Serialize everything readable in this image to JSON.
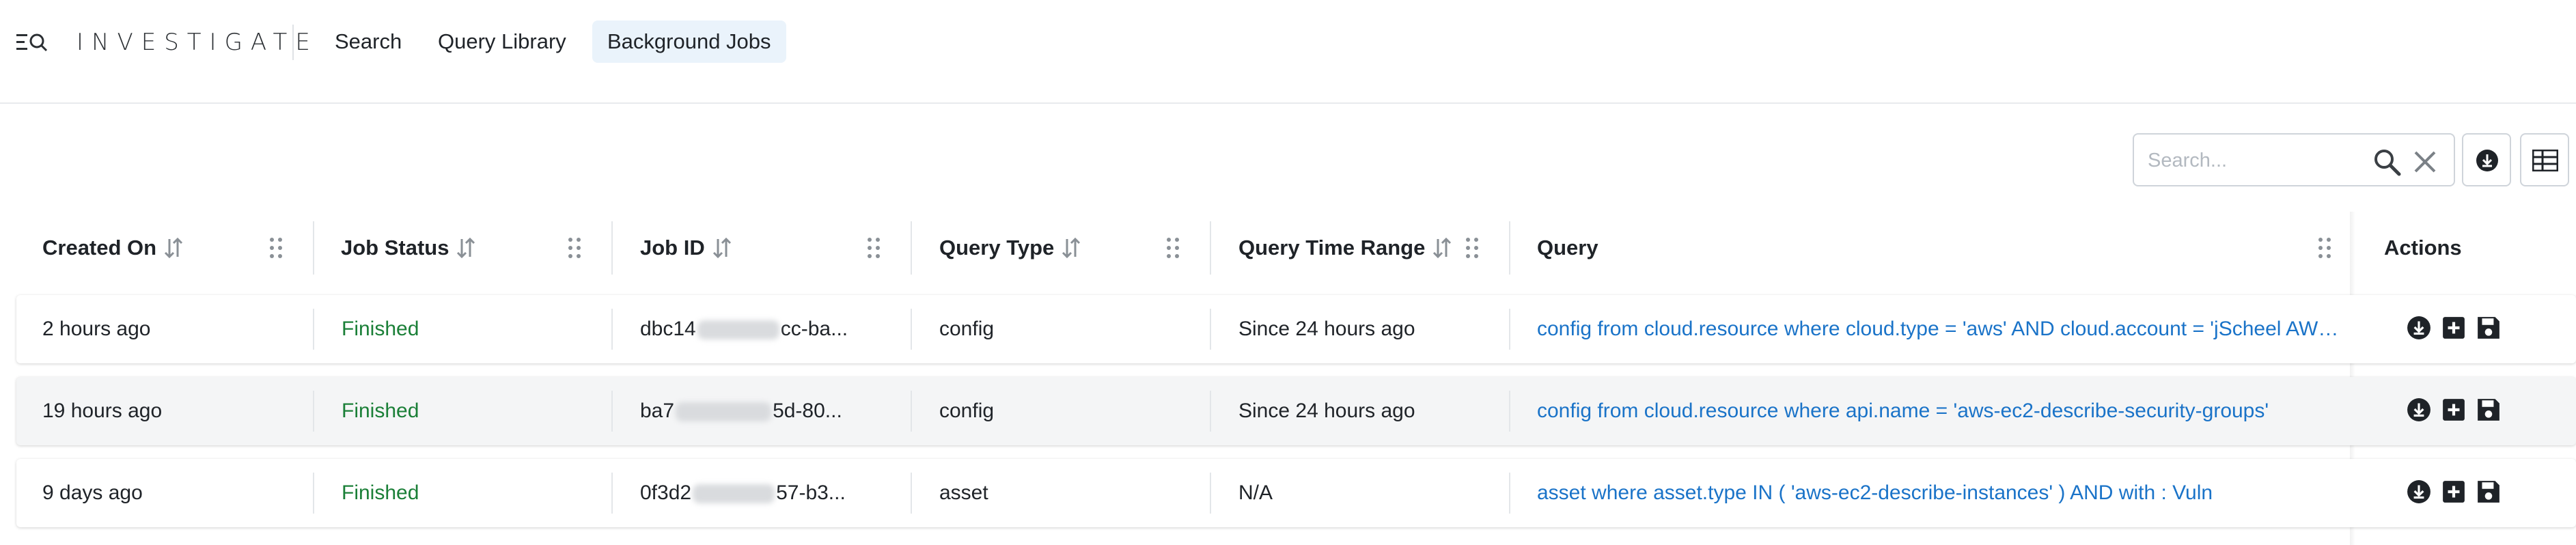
{
  "nav": {
    "brand": "INVESTIGATE",
    "menu_icon": "menu-search-icon",
    "items": [
      {
        "label": "Search",
        "active": false
      },
      {
        "label": "Query Library",
        "active": false
      },
      {
        "label": "Background Jobs",
        "active": true
      }
    ]
  },
  "toolbar": {
    "search_placeholder": "Search...",
    "search_icon": "magnifier-icon",
    "clear_icon": "close-icon",
    "download_icon": "download-icon",
    "columns_icon": "columns-icon"
  },
  "table": {
    "columns": [
      {
        "label": "Created On",
        "sortable": true
      },
      {
        "label": "Job Status",
        "sortable": true
      },
      {
        "label": "Job ID",
        "sortable": true
      },
      {
        "label": "Query Type",
        "sortable": true
      },
      {
        "label": "Query Time Range",
        "sortable": true
      },
      {
        "label": "Query",
        "sortable": false
      },
      {
        "label": "Actions",
        "sortable": false
      }
    ],
    "rows": [
      {
        "created_on": "2 hours ago",
        "job_status": "Finished",
        "job_id_prefix": "dbc14",
        "job_id_suffix": "cc-ba...",
        "query_type": "config",
        "time_range": "Since 24 hours ago",
        "query": "config from cloud.resource where cloud.type = 'aws' AND cloud.account = 'jScheel AWS ..."
      },
      {
        "created_on": "19 hours ago",
        "job_status": "Finished",
        "job_id_prefix": "ba7",
        "job_id_suffix": "5d-80...",
        "query_type": "config",
        "time_range": "Since 24 hours ago",
        "query": "config from cloud.resource where api.name = 'aws-ec2-describe-security-groups'"
      },
      {
        "created_on": "9 days ago",
        "job_status": "Finished",
        "job_id_prefix": "0f3d2",
        "job_id_suffix": "57-b3...",
        "query_type": "asset",
        "time_range": "N/A",
        "query": "asset where asset.type IN ( 'aws-ec2-describe-instances' ) AND with : Vuln"
      }
    ],
    "row_actions": [
      "download-icon",
      "add-icon",
      "save-icon"
    ]
  },
  "colors": {
    "status_finished": "#1a7f37",
    "query_link": "#1a73c8",
    "active_nav_bg": "#eaf3fb"
  }
}
